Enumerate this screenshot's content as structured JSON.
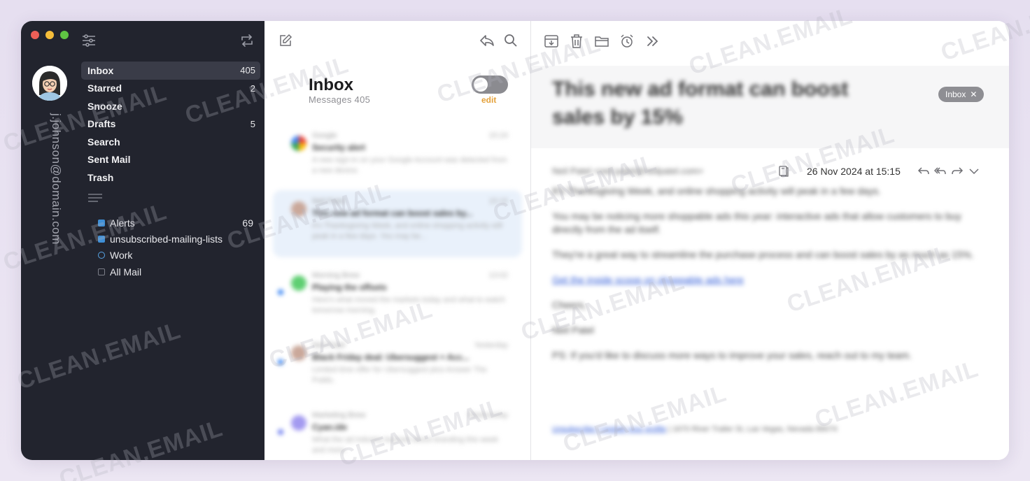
{
  "user": {
    "email": "j.johnson@domain.com"
  },
  "nav": {
    "items": [
      {
        "label": "Inbox",
        "count": "405"
      },
      {
        "label": "Starred",
        "count": "2"
      },
      {
        "label": "Snooze",
        "count": ""
      },
      {
        "label": "Drafts",
        "count": "5"
      },
      {
        "label": "Search",
        "count": ""
      },
      {
        "label": "Sent Mail",
        "count": ""
      },
      {
        "label": "Trash",
        "count": ""
      }
    ]
  },
  "folders": [
    {
      "label": "Alerts",
      "count": "69"
    },
    {
      "label": "unsubscribed-mailing-lists",
      "count": ""
    },
    {
      "label": "Work",
      "count": ""
    },
    {
      "label": "All Mail",
      "count": ""
    }
  ],
  "list": {
    "title": "Inbox",
    "subtitle": "Messages 405",
    "edit_label": "edit",
    "messages": [
      {
        "from": "Google",
        "time": "15:24",
        "subject": "Security alert",
        "snippet": "A new sign-in on your Google Account was detected from a new device."
      },
      {
        "from": "Neil Patel",
        "time": "15:15",
        "subject": "This new ad format can boost sales by...",
        "snippet": "It's Thanksgiving Week, and online shopping activity will peak in a few days. You may be..."
      },
      {
        "from": "Morning Brew",
        "time": "13:02",
        "subject": "Playing the offsets",
        "snippet": "Here's what moved the markets today and what to watch tomorrow morning."
      },
      {
        "from": "Neil Patel",
        "time": "Yesterday",
        "subject": "Black Friday deal: Ubersuggest + Acc...",
        "snippet": "Limited time offer for Ubersuggest plus Answer The Public."
      },
      {
        "from": "Marketing Brew",
        "time": "Wednesday",
        "subject": "Cyan.ide",
        "snippet": "What the ad industry learned about branding this week and more."
      }
    ]
  },
  "reader": {
    "subject": "This new ad format can boost sales by 15%",
    "tag": "Inbox",
    "sender": "Neil Patel <neil.patel@neilpatel.com>",
    "datetime": "26 Nov 2024 at 15:15",
    "body": [
      "It's Thanksgiving Week, and online shopping activity will peak in a few days.",
      "You may be noticing more shoppable ads this year: interactive ads that allow customers to buy directly from the ad itself.",
      "They're a great way to streamline the purchase process and can boost sales by as much as 15%.",
      "Get the inside scoop on shoppable ads here",
      "Cheers,",
      "Neil Patel",
      "PS: If you'd like to discuss more ways to improve your sales, reach out to my team."
    ],
    "footer_link": "Unsubscribe | Update your profile",
    "footer_address": "| 1670 River Trailer St, Las Vegas, Nevada 89074"
  },
  "watermark": "CLEAN.EMAIL",
  "colors": {
    "sidebar_bg": "#22242e",
    "accent_blue": "#2f7ff3",
    "edit_orange": "#e4a13a"
  }
}
